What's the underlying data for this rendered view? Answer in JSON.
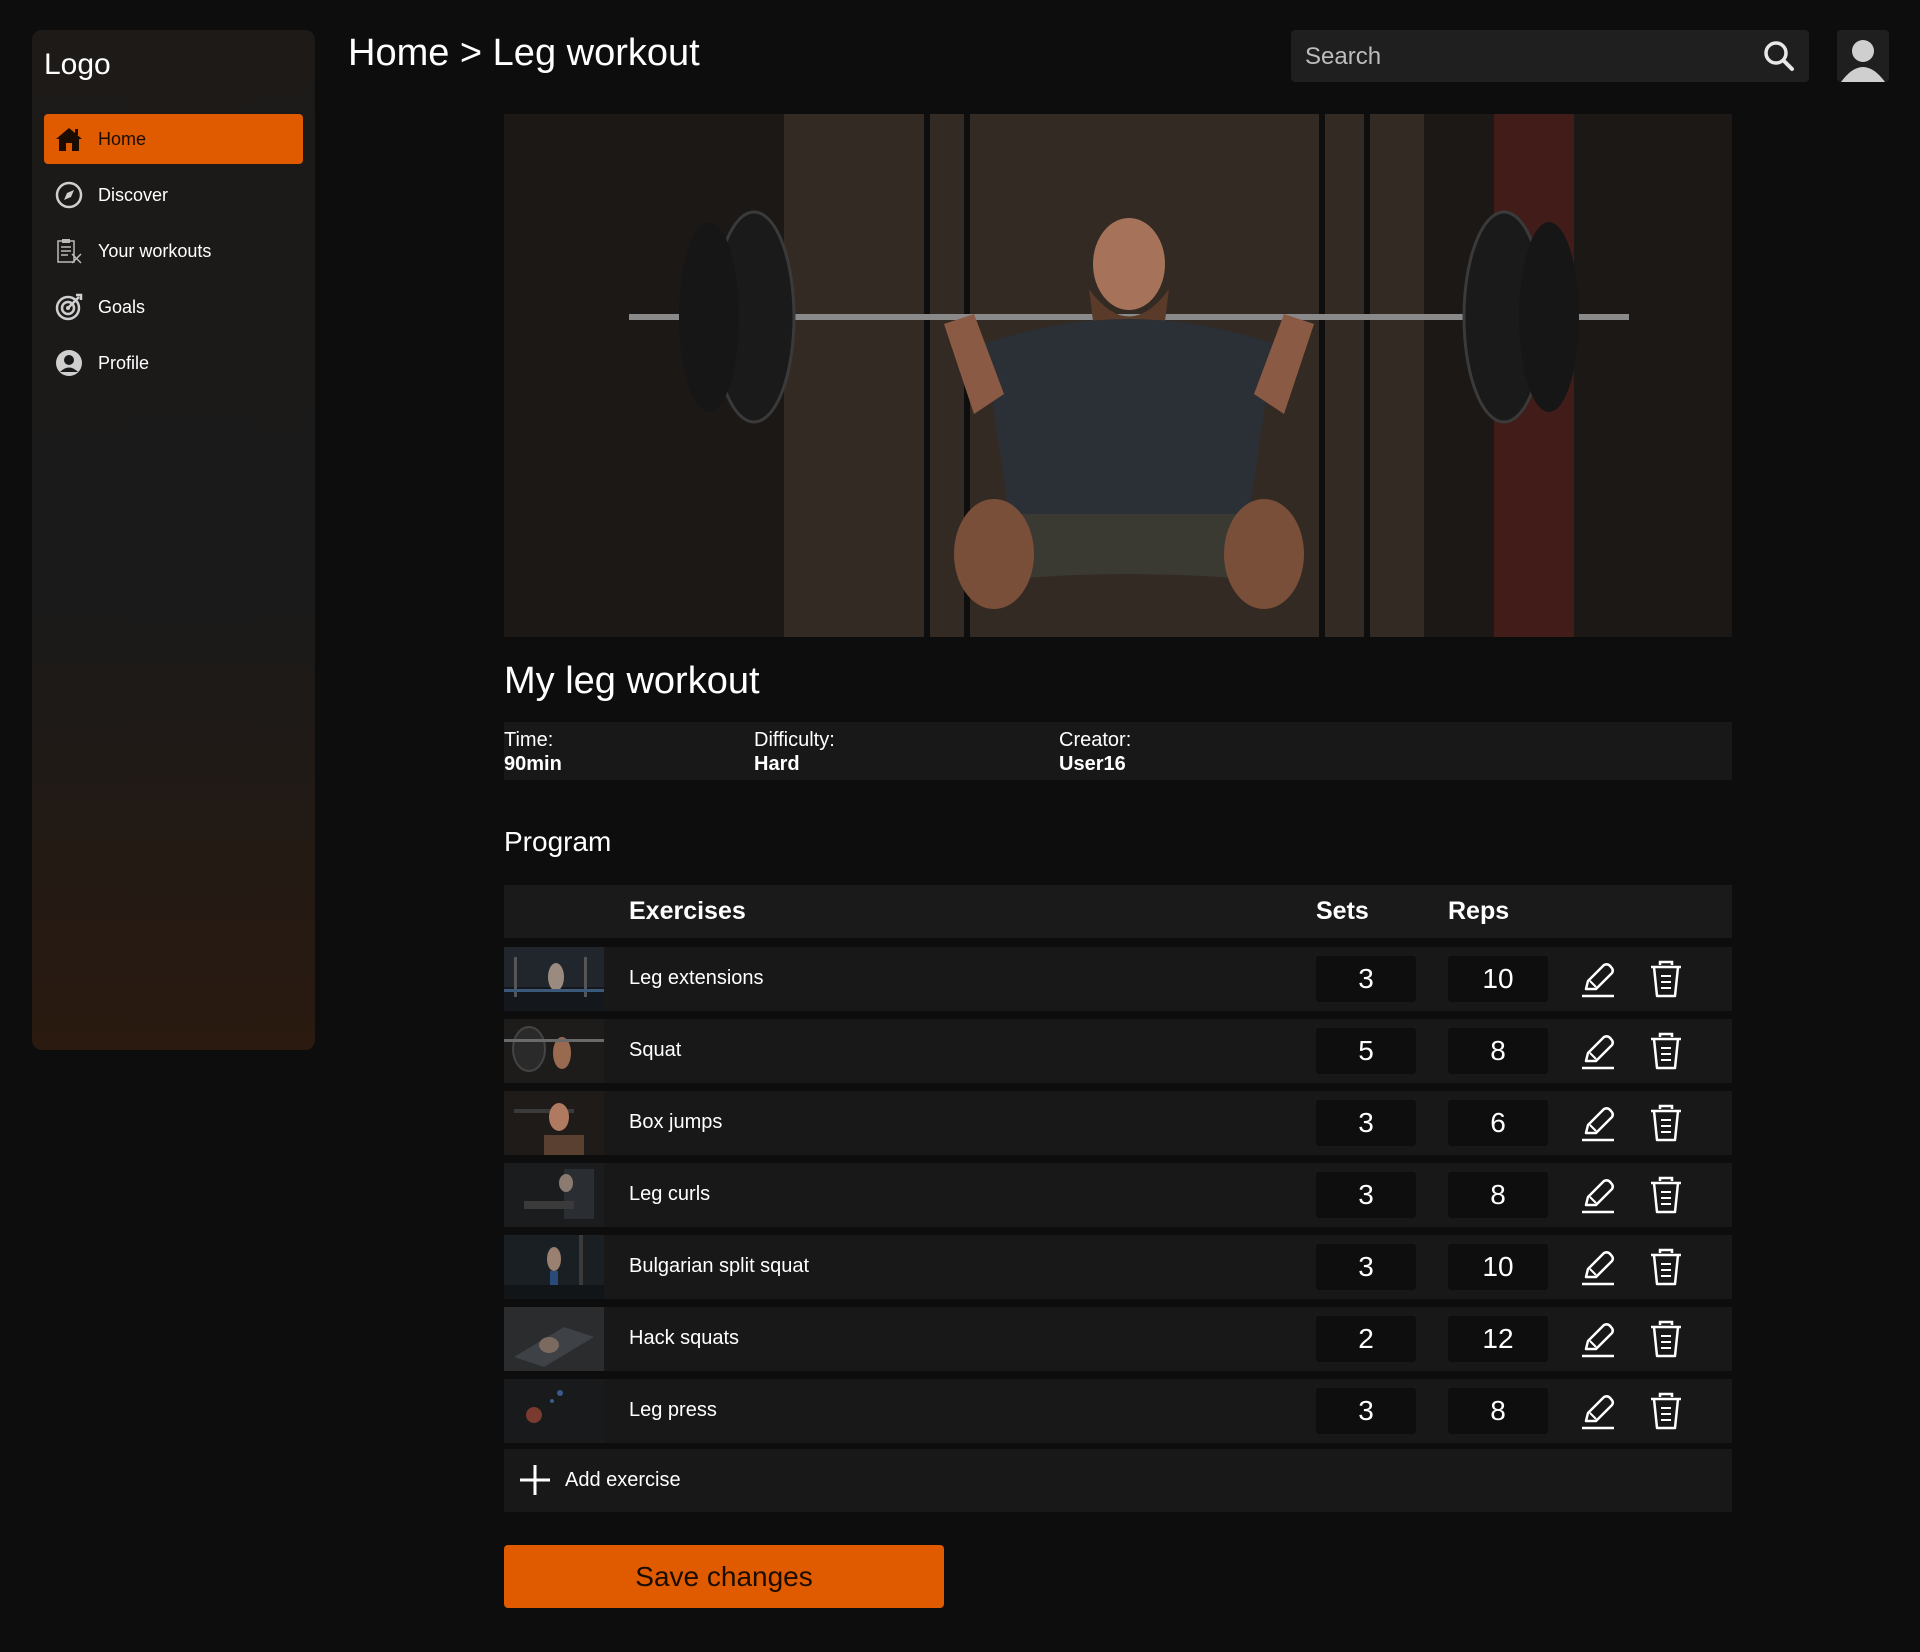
{
  "sidebar": {
    "logo": "Logo",
    "items": [
      {
        "label": "Home",
        "icon": "home-icon",
        "active": true
      },
      {
        "label": "Discover",
        "icon": "compass-icon"
      },
      {
        "label": "Your workouts",
        "icon": "clipboard-icon"
      },
      {
        "label": "Goals",
        "icon": "target-icon"
      },
      {
        "label": "Profile",
        "icon": "user-circle-icon"
      }
    ]
  },
  "header": {
    "breadcrumb": "Home > Leg workout",
    "search_placeholder": "Search"
  },
  "workout": {
    "title": "My leg workout",
    "time_label": "Time:",
    "time_value": "90min",
    "difficulty_label": "Difficulty:",
    "difficulty_value": "Hard",
    "creator_label": "Creator:",
    "creator_value": "User16"
  },
  "program": {
    "title": "Program",
    "headers": {
      "exercises": "Exercises",
      "sets": "Sets",
      "reps": "Reps"
    },
    "rows": [
      {
        "name": "Leg extensions",
        "sets": "3",
        "reps": "10"
      },
      {
        "name": "Squat",
        "sets": "5",
        "reps": "8"
      },
      {
        "name": "Box jumps",
        "sets": "3",
        "reps": "6"
      },
      {
        "name": "Leg curls",
        "sets": "3",
        "reps": "8"
      },
      {
        "name": "Bulgarian split squat",
        "sets": "3",
        "reps": "10"
      },
      {
        "name": "Hack squats",
        "sets": "2",
        "reps": "12"
      },
      {
        "name": "Leg press",
        "sets": "3",
        "reps": "8"
      }
    ],
    "add_label": "Add exercise"
  },
  "save_label": "Save changes",
  "colors": {
    "accent": "#e05a00",
    "background": "#0d0d0d",
    "panel": "#181818"
  }
}
